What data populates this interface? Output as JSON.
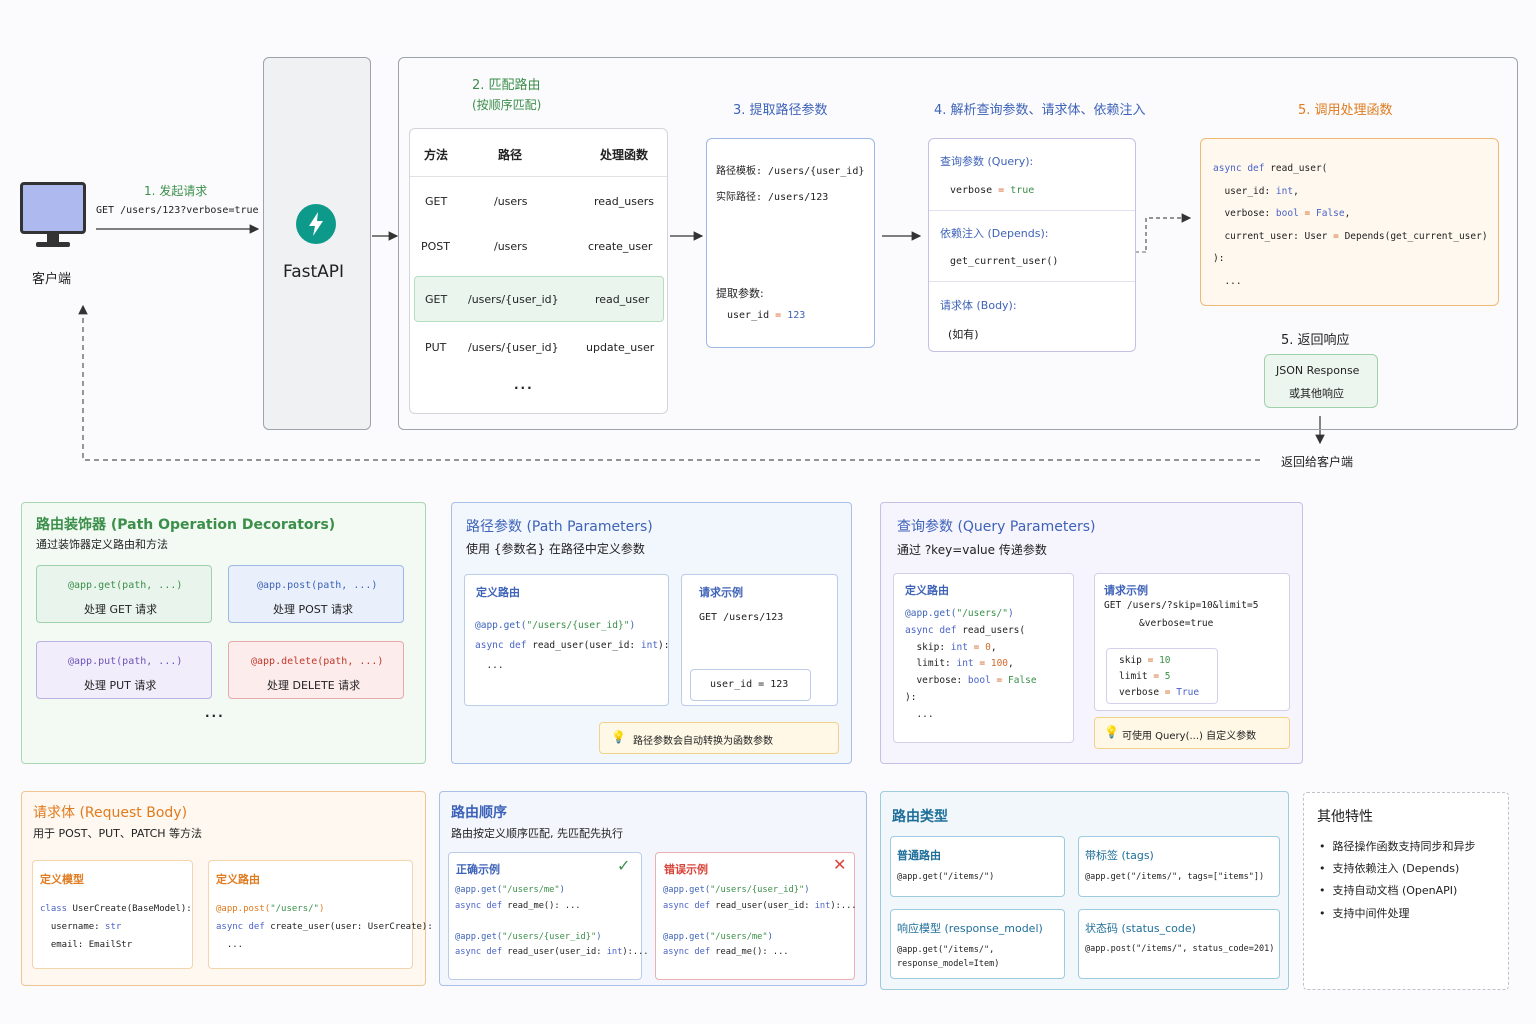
{
  "flow": {
    "client_label": "客户端",
    "step1_title": "1. 发起请求",
    "step1_request": "GET /users/123?verbose=true",
    "fastapi_label": "FastAPI",
    "step2_title": "2. 匹配路由",
    "step2_subtitle": "(按顺序匹配)",
    "route_table": {
      "headers": [
        "方法",
        "路径",
        "处理函数"
      ],
      "rows": [
        [
          "GET",
          "/users",
          "read_users"
        ],
        [
          "POST",
          "/users",
          "create_user"
        ],
        [
          "GET",
          "/users/{user_id}",
          "read_user"
        ],
        [
          "PUT",
          "/users/{user_id}",
          "update_user"
        ]
      ],
      "more": "..."
    },
    "step3_title": "3. 提取路径参数",
    "step3": {
      "template_label": "路径模板: /users/{user_id}",
      "actual_label": "实际路径: /users/123",
      "extract_label": "提取参数:",
      "param_name": "user_id",
      "param_eq": " = ",
      "param_value": "123"
    },
    "step4_title": "4. 解析查询参数、请求体、依赖注入",
    "step4": {
      "query_title": "查询参数 (Query):",
      "query_name": "verbose",
      "query_eq": " = ",
      "query_value": "true",
      "depends_title": "依赖注入 (Depends):",
      "depends_value": "get_current_user()",
      "body_title": "请求体 (Body):",
      "body_value": "(如有)"
    },
    "step5_title": "5. 调用处理函数",
    "step5_code": [
      "async def read_user(",
      "  user_id: int,",
      "  verbose: bool = False,",
      "  current_user: User = Depends(get_current_user)",
      "):",
      "  ..."
    ],
    "step6_title": "5. 返回响应",
    "response_line1": "JSON Response",
    "response_line2": "或其他响应",
    "return_label": "返回给客户端"
  },
  "decorators": {
    "title": "路由装饰器 (Path Operation Decorators)",
    "subtitle": "通过装饰器定义路由和方法",
    "items": [
      {
        "code": "@app.get(path, ...)",
        "desc": "处理 GET 请求",
        "color": "#e9f5ec",
        "border": "#9fd1ac",
        "codecolor": "#3b8f4a"
      },
      {
        "code": "@app.post(path, ...)",
        "desc": "处理 POST 请求",
        "color": "#e9f0fb",
        "border": "#9db8e6",
        "codecolor": "#3e63b8"
      },
      {
        "code": "@app.put(path, ...)",
        "desc": "处理 PUT 请求",
        "color": "#f1edfa",
        "border": "#bdb0e3",
        "codecolor": "#6a55b8"
      },
      {
        "code": "@app.delete(path, ...)",
        "desc": "处理 DELETE 请求",
        "color": "#fcecec",
        "border": "#e7a9a9",
        "codecolor": "#c0392b"
      }
    ],
    "more": "..."
  },
  "path_params": {
    "title": "路径参数 (Path Parameters)",
    "subtitle": "使用 {参数名} 在路径中定义参数",
    "define_title": "定义路由",
    "define_code": [
      "@app.get(\"/users/{user_id}\")",
      "async def read_user(user_id: int):",
      "  ..."
    ],
    "example_title": "请求示例",
    "example_request": "GET /users/123",
    "example_result": "user_id = 123",
    "tip": "路径参数会自动转换为函数参数"
  },
  "query_params": {
    "title": "查询参数 (Query Parameters)",
    "subtitle": "通过 ?key=value 传递参数",
    "define_title": "定义路由",
    "define_code": [
      "@app.get(\"/users/\")",
      "async def read_users(",
      "  skip: int = 0,",
      "  limit: int = 100,",
      "  verbose: bool = False",
      "):",
      "  ..."
    ],
    "example_title": "请求示例",
    "example_request_1": "GET /users/?skip=10&limit=5",
    "example_request_2": "&verbose=true",
    "example_result": [
      "skip = 10",
      "limit = 5",
      "verbose = True"
    ],
    "tip": "可使用 Query(...) 自定义参数"
  },
  "request_body": {
    "title": "请求体 (Request Body)",
    "subtitle": "用于 POST、PUT、PATCH 等方法",
    "model_title": "定义模型",
    "model_code": [
      "class UserCreate(BaseModel):",
      "  username: str",
      "  email: EmailStr"
    ],
    "route_title": "定义路由",
    "route_code": [
      "@app.post(\"/users/\")",
      "async def create_user(user: UserCreate):",
      "  ..."
    ]
  },
  "route_order": {
    "title": "路由顺序",
    "subtitle": "路由按定义顺序匹配, 先匹配先执行",
    "correct_title": "正确示例",
    "correct_code": [
      "@app.get(\"/users/me\")",
      "async def read_me(): ...",
      "",
      "@app.get(\"/users/{user_id}\")",
      "async def read_user(user_id: int):..."
    ],
    "wrong_title": "错误示例",
    "wrong_code": [
      "@app.get(\"/users/{user_id}\")",
      "async def read_user(user_id: int):...",
      "",
      "@app.get(\"/users/me\")",
      "async def read_me(): ..."
    ]
  },
  "route_types": {
    "title": "路由类型",
    "items": [
      {
        "title": "普通路由",
        "code": "@app.get(\"/items/\")"
      },
      {
        "title": "带标签 (tags)",
        "code": "@app.get(\"/items/\", tags=[\"items\"])"
      },
      {
        "title": "响应模型 (response_model)",
        "code": "@app.get(\"/items/\",\nresponse_model=Item)"
      },
      {
        "title": "状态码 (status_code)",
        "code": "@app.post(\"/items/\", status_code=201)"
      }
    ]
  },
  "other": {
    "title": "其他特性",
    "items": [
      "路径操作函数支持同步和异步",
      "支持依赖注入 (Depends)",
      "支持自动文档 (OpenAPI)",
      "支持中间件处理"
    ]
  },
  "colors": {
    "green": "#3b8f4a",
    "blue": "#3e63b8",
    "purple": "#6a55b8",
    "orange": "#e07b1f",
    "red": "#d9443a",
    "fastapi": "#0e9a8a"
  }
}
